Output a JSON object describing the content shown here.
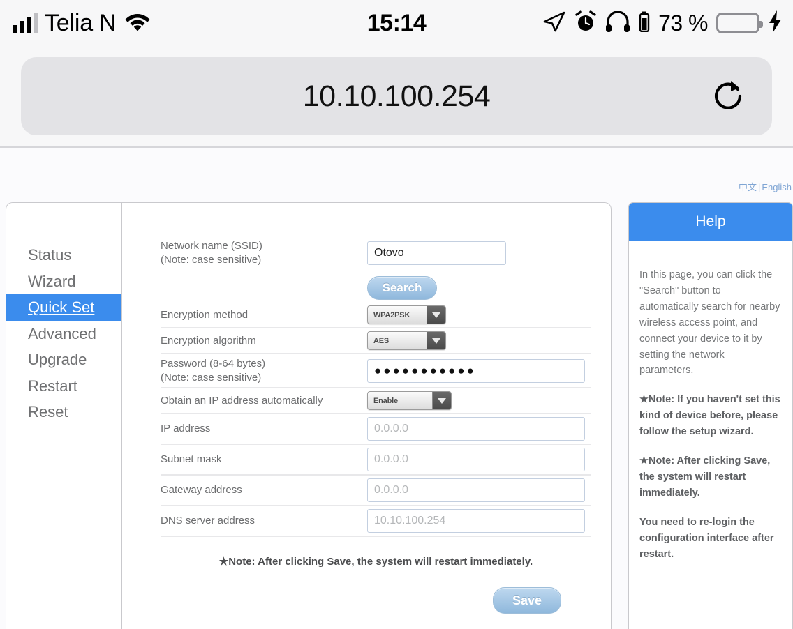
{
  "status_bar": {
    "carrier": "Telia N",
    "time": "15:14",
    "battery_percent": "73 %",
    "icons": [
      "signal-bars-icon",
      "wifi-icon",
      "location-arrow-icon",
      "alarm-clock-icon",
      "headphones-icon",
      "headphone-battery-icon",
      "battery-icon",
      "charging-bolt-icon"
    ],
    "battery_fill_color": "#6ddc6d"
  },
  "browser": {
    "url": "10.10.100.254",
    "reload_label": "reload-icon"
  },
  "language": {
    "chinese": "中文",
    "separator": "|",
    "english": "English"
  },
  "sidebar": {
    "items": [
      {
        "label": "Status",
        "active": false
      },
      {
        "label": "Wizard",
        "active": false
      },
      {
        "label": "Quick Set",
        "active": true
      },
      {
        "label": "Advanced",
        "active": false
      },
      {
        "label": "Upgrade",
        "active": false
      },
      {
        "label": "Restart",
        "active": false
      },
      {
        "label": "Reset",
        "active": false
      }
    ],
    "active_bg": "#3b8ced"
  },
  "form": {
    "ssid": {
      "label_line1": "Network name (SSID)",
      "label_line2": "(Note: case sensitive)",
      "value": "Otovo"
    },
    "search_button": "Search",
    "encryption_method": {
      "label": "Encryption method",
      "value": "WPA2PSK"
    },
    "encryption_algorithm": {
      "label": "Encryption algorithm",
      "value": "AES"
    },
    "password": {
      "label_line1": "Password (8-64 bytes)",
      "label_line2": "(Note: case sensitive)",
      "value": "●●●●●●●●●●●"
    },
    "obtain_ip": {
      "label": "Obtain an IP address automatically",
      "value": "Enable"
    },
    "ip_address": {
      "label": "IP address",
      "value": "0.0.0.0"
    },
    "subnet_mask": {
      "label": "Subnet mask",
      "value": "0.0.0.0"
    },
    "gateway_address": {
      "label": "Gateway address",
      "value": "0.0.0.0"
    },
    "dns_server_address": {
      "label": "DNS server address",
      "value": "10.10.100.254"
    },
    "note": "★Note: After clicking Save, the system will restart immediately.",
    "save_button": "Save"
  },
  "help": {
    "title": "Help",
    "paragraphs": [
      "In this page, you can click the \"Search\" button to automatically search for nearby wireless access point, and connect your device to it by setting the network parameters.",
      "★Note: If you haven't set this kind of device before, please follow the setup wizard.",
      "★Note: After clicking Save, the system will restart immediately.",
      "You need to re-login the configuration interface after restart."
    ],
    "header_color": "#3b8ced"
  }
}
